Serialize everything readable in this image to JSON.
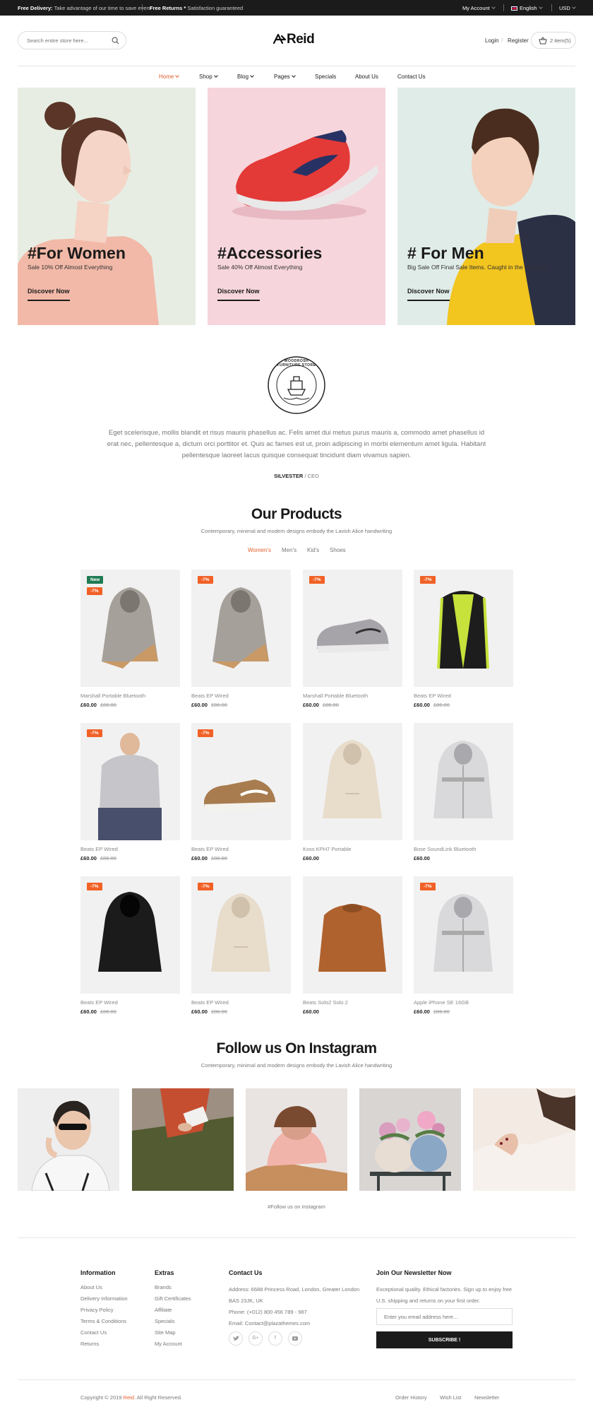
{
  "topbar": {
    "free_delivery_label": "Free Delivery:",
    "free_delivery_text": "Take advantage of our time to save event",
    "free_returns_label": "Free Returns *",
    "free_returns_text": "Satisfaction guaranteed",
    "my_account": "My Account",
    "language": "English",
    "currency": "USD"
  },
  "header": {
    "search_placeholder": "Search entire store here...",
    "logo": "Reid",
    "login": "Login",
    "register": "Register",
    "cart_label": "2 item(5)"
  },
  "nav": [
    "Home",
    "Shop",
    "Blog",
    "Pages",
    "Specials",
    "About Us",
    "Contact Us"
  ],
  "banners": [
    {
      "title": "#For Women",
      "subtitle": "Sale 10% Off Almost Everything",
      "cta": "Discover Now",
      "bg": "#e7ede3"
    },
    {
      "title": "#Accessories",
      "subtitle": "Sale 40% Off Almost Everything",
      "cta": "Discover Now",
      "bg": "#f6d5dc"
    },
    {
      "title": "# For Men",
      "subtitle": "Big Sale Off Final Sale Items. Caught in the moment",
      "cta": "Discover Now",
      "bg": "#e0ece8"
    }
  ],
  "testimonial": {
    "badge_text": "WOODROSH FURNITURE STORE",
    "quote": "Eget scelerisque, mollis blandit et risus mauris phasellus ac. Felis amet dui metus purus mauris a, commodo amet phasellus id erat nec, pellentesque a, dictum orci porttitor et. Quis ac fames est ut, proin adipiscing in morbi elementum amet ligula. Habitant pellentesque laoreet lacus quisque consequat tincidunt diam vivamus sapien.",
    "author": "SILVESTER",
    "role": "/ CEO"
  },
  "products_section": {
    "title": "Our Products",
    "subtitle": "Contemporary, minimal and modern designs embody the Lavish Alice handwriting",
    "tabs": [
      "Women's",
      "Men's",
      "Kid's",
      "Shoes"
    ]
  },
  "products": [
    {
      "name": "Marshall Portable Bluetooth",
      "price": "£60.00",
      "old_price": "£86.00",
      "badges": [
        "New",
        "-7%"
      ],
      "kind": "hoodie-grey"
    },
    {
      "name": "Beats EP Wired",
      "price": "£60.00",
      "old_price": "£86.00",
      "badges": [
        "-7%"
      ],
      "kind": "hoodie-grey"
    },
    {
      "name": "Marshall Portable Bluetooth",
      "price": "£60.00",
      "old_price": "£86.00",
      "badges": [
        "-7%"
      ],
      "kind": "shoe-grey"
    },
    {
      "name": "Beats EP Wired",
      "price": "£60.00",
      "old_price": "£86.00",
      "badges": [
        "-7%"
      ],
      "kind": "vest"
    },
    {
      "name": "Beats EP Wired",
      "price": "£60.00",
      "old_price": "£86.00",
      "badges": [
        "-7%"
      ],
      "kind": "jacket-man"
    },
    {
      "name": "Beats EP Wired",
      "price": "£60.00",
      "old_price": "£86.00",
      "badges": [
        "-7%"
      ],
      "kind": "shoe-tan"
    },
    {
      "name": "Koss KPH7 Portable",
      "price": "£60.00",
      "old_price": "",
      "badges": [],
      "kind": "hoodie-cream"
    },
    {
      "name": "Bose SoundLink Bluetooth",
      "price": "£60.00",
      "old_price": "",
      "badges": [],
      "kind": "jacket-white"
    },
    {
      "name": "Beats EP Wired",
      "price": "£60.00",
      "old_price": "£86.00",
      "badges": [
        "-7%"
      ],
      "kind": "hoodie-black"
    },
    {
      "name": "Beats EP Wired",
      "price": "£60.00",
      "old_price": "£86.00",
      "badges": [
        "-7%"
      ],
      "kind": "hoodie-cream"
    },
    {
      "name": "Beats Solo2 Solo 2",
      "price": "£60.00",
      "old_price": "",
      "badges": [],
      "kind": "sweater-rust"
    },
    {
      "name": "Apple iPhone SE 16GB",
      "price": "£60.00",
      "old_price": "£86.00",
      "badges": [
        "-7%"
      ],
      "kind": "jacket-white"
    }
  ],
  "instagram": {
    "title": "Follow us On Instagram",
    "subtitle": "Contemporary, minimal and modern designs embody the Lavish Alice handwriting",
    "link": "#Follow us on Instagram"
  },
  "footer": {
    "information": {
      "title": "Information",
      "links": [
        "About Us",
        "Delivery Information",
        "Privacy Policy",
        "Terms & Conditions",
        "Contact Us",
        "Returns"
      ]
    },
    "extras": {
      "title": "Extras",
      "links": [
        "Brands",
        "Gift Certificates",
        "Affiliate",
        "Specials",
        "Site Map",
        "My Account"
      ]
    },
    "contact": {
      "title": "Contact Us",
      "address_1": "Address: 6688 Princess Road, London, Greater London",
      "address_2": "BAS 23JK, UK",
      "phone": "Phone: (+012) 800 456 789 - 987",
      "email": "Email: Contact@plazathemes.com"
    },
    "social": [
      "twitter",
      "google-plus",
      "facebook",
      "youtube"
    ],
    "newsletter": {
      "title": "Join Our Newsletter Now",
      "text_1": "Exceptional quality. Ethical factories. Sign up to enjoy free",
      "text_2": "U.S. shipping and returns on your first order.",
      "placeholder": "Enter you email address here...",
      "button": "SUBSCRIBE !"
    },
    "copyright_prefix": "Copyright © 2019",
    "copyright_brand": "Reid",
    "copyright_suffix": ". All Right Reserved.",
    "bottom_links": [
      "Order History",
      "Wish List",
      "Newsletter"
    ]
  },
  "colors": {
    "accent": "#e35f2d",
    "badge_new": "#1f7a52",
    "badge_sale": "#f16126",
    "dark": "#1b1b1b"
  }
}
